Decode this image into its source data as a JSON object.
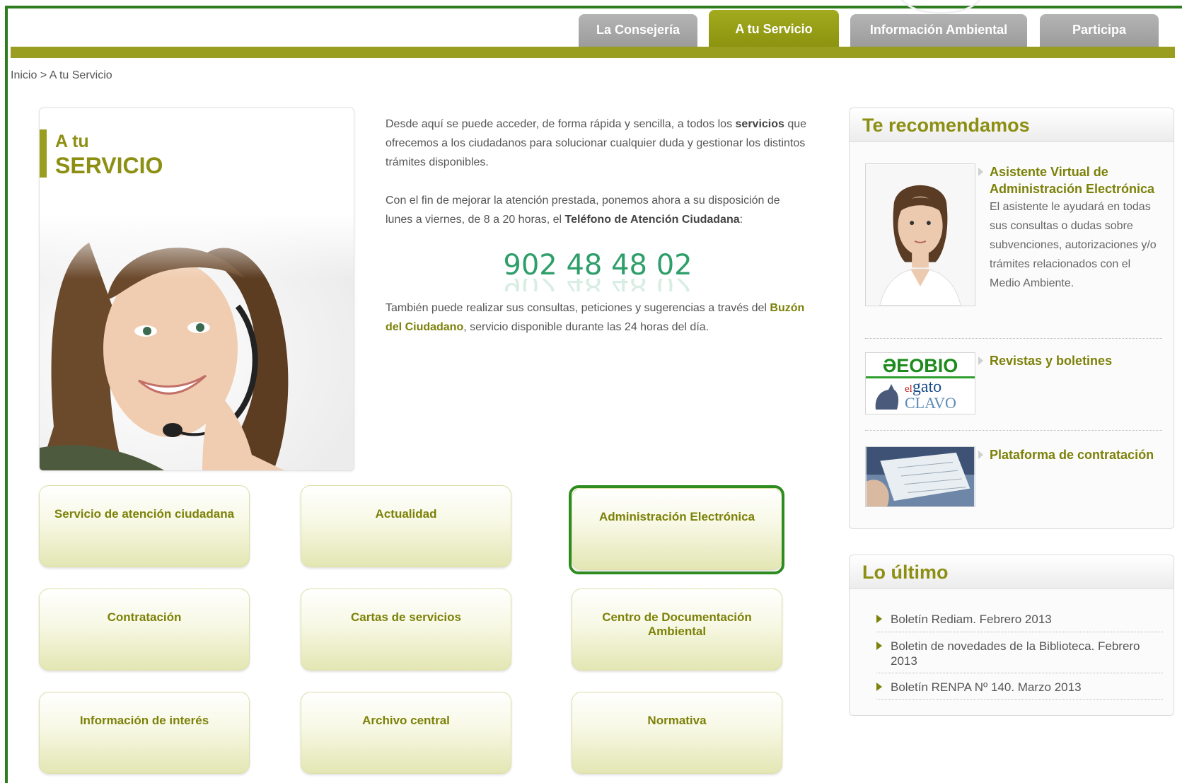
{
  "nav": {
    "tabs": [
      {
        "label": "La Consejería"
      },
      {
        "label": "A tu Servicio"
      },
      {
        "label": "Información Ambiental"
      },
      {
        "label": "Participa"
      }
    ]
  },
  "breadcrumb": {
    "home": "Inicio",
    "separator": ">",
    "current": "A tu Servicio"
  },
  "hero": {
    "title_small": "A tu",
    "title_big": "SERVICIO"
  },
  "intro": {
    "p1_a": "Desde aquí se puede acceder, de forma rápida y sencilla, a todos los",
    "p1_bold": "servicios",
    "p1_b": "que ofrecemos a los ciudadanos para solucionar cualquier duda y gestionar los distintos trámites disponibles.",
    "p2_a": "Con el fin de mejorar la atención prestada, ponemos ahora a su disposición de lunes a viernes, de 8 a 20 horas, el",
    "p2_bold": "Teléfono de Atención Ciudadana",
    "p2_b": ":",
    "phone": "902 48 48 02",
    "p3_a": "También puede realizar sus consultas, peticiones y sugerencias a través del",
    "p3_link": "Buzón del Ciudadano",
    "p3_b": ", servicio disponible durante las 24 horas del día."
  },
  "services": [
    {
      "label": "Servicio de atención ciudadana"
    },
    {
      "label": "Actualidad"
    },
    {
      "label": "Administración Electrónica"
    },
    {
      "label": "Contratación"
    },
    {
      "label": "Cartas de servicios"
    },
    {
      "label": "Centro de Documentación Ambiental"
    },
    {
      "label": "Información de interés"
    },
    {
      "label": "Archivo central"
    },
    {
      "label": "Normativa"
    }
  ],
  "recommend": {
    "heading": "Te recomendamos",
    "items": [
      {
        "title": "Asistente Virtual de Administración Electrónica",
        "text": "El asistente le ayudará en todas sus consultas o dudas sobre subvenciones, autorizaciones y/o trámites relacionados con el Medio Ambiente."
      },
      {
        "title": "Revistas y boletines",
        "logo_top": "ƏEOBIO",
        "logo_el": "el",
        "logo_gato": "gato",
        "logo_clavo": "CLAVO"
      },
      {
        "title": "Plataforma de contratación"
      }
    ]
  },
  "latest": {
    "heading": "Lo último",
    "items": [
      {
        "label": "Boletín Rediam. Febrero 2013"
      },
      {
        "label": "Boletin de novedades de la Biblioteca. Febrero 2013"
      },
      {
        "label": "Boletín RENPA Nº 140. Marzo 2013"
      }
    ]
  },
  "colors": {
    "olive": "#999e21",
    "olive_text": "#7c8108",
    "tab_grey": "#a8a8a8",
    "phone_green": "#2e9e6a",
    "highlight_green": "#2e8b1f"
  }
}
